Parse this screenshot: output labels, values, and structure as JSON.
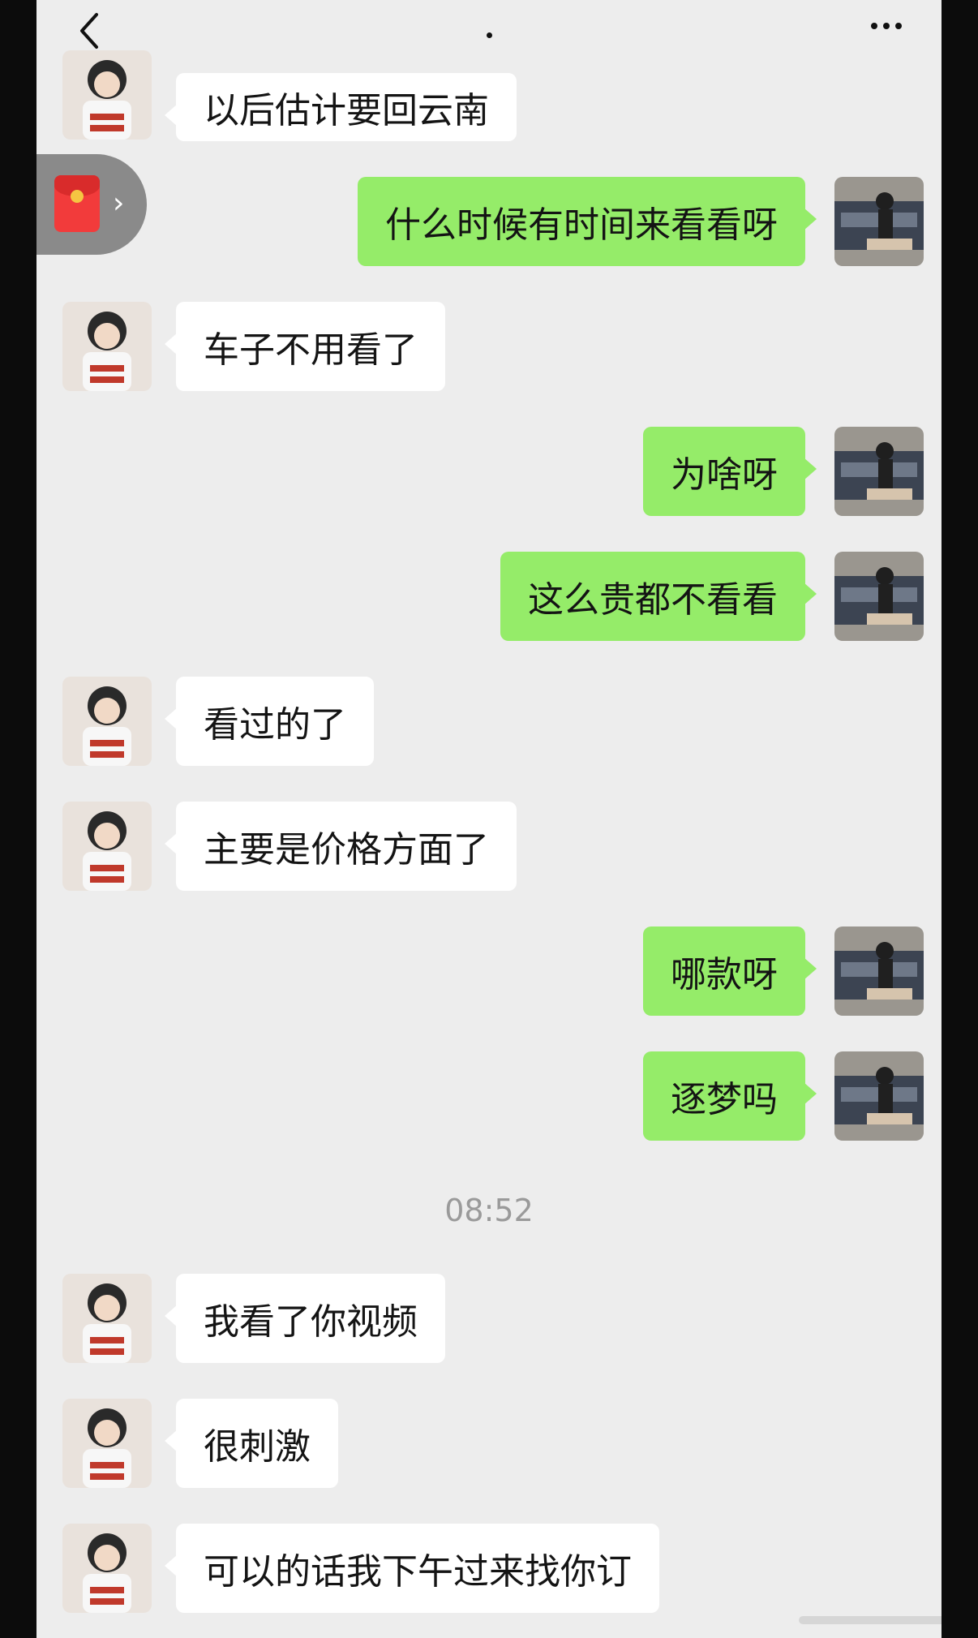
{
  "header": {
    "back_icon": "chevron-left-icon",
    "more_icon": "ellipsis-icon"
  },
  "floating_shortcut": {
    "icon": "red-packet-icon",
    "arrow_icon": "chevron-right-icon"
  },
  "messages": [
    {
      "side": "in",
      "text": "以后估计要回云南"
    },
    {
      "side": "out",
      "text": "什么时候有时间来看看呀"
    },
    {
      "side": "in",
      "text": "车子不用看了"
    },
    {
      "side": "out",
      "text": "为啥呀"
    },
    {
      "side": "out",
      "text": "这么贵都不看看"
    },
    {
      "side": "in",
      "text": "看过的了"
    },
    {
      "side": "in",
      "text": "主要是价格方面了"
    },
    {
      "side": "out",
      "text": "哪款呀"
    },
    {
      "side": "out",
      "text": "逐梦吗"
    },
    {
      "side": "in",
      "text": "我看了你视频"
    },
    {
      "side": "in",
      "text": "很刺激"
    },
    {
      "side": "in",
      "text": "可以的话我下午过来找你订"
    }
  ],
  "timestamp": "08:52",
  "colors": {
    "background": "#ededed",
    "incoming_bubble": "#ffffff",
    "outgoing_bubble": "#95ec69"
  }
}
